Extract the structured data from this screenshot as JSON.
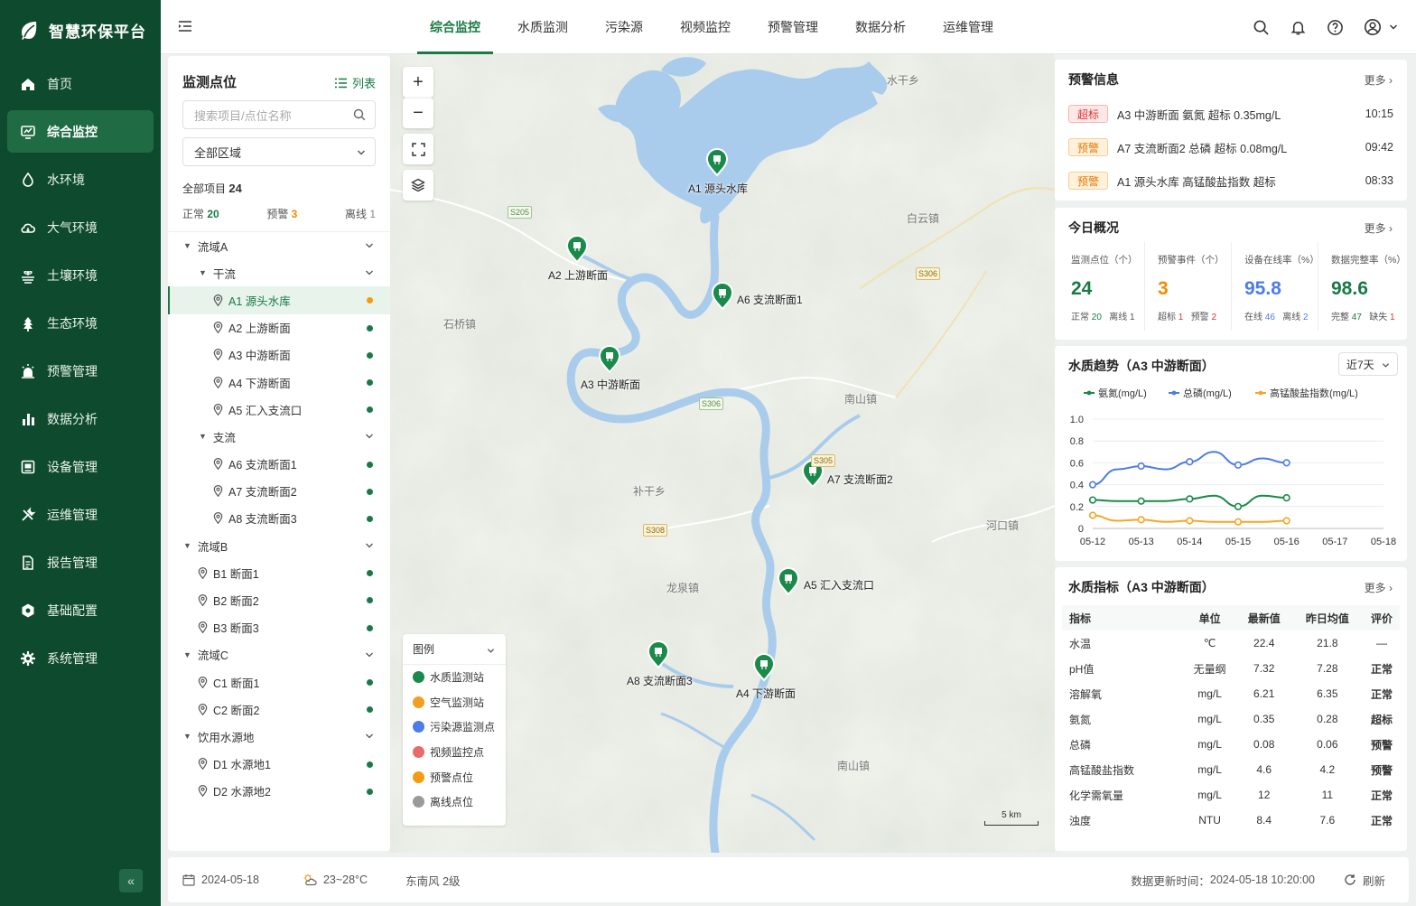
{
  "brand": {
    "title": "智慧环保平台"
  },
  "nav": {
    "items": [
      {
        "label": "首页",
        "icon": "home-icon"
      },
      {
        "label": "综合监控",
        "icon": "monitor-icon",
        "active": true
      },
      {
        "label": "水环境",
        "icon": "water-drop-icon"
      },
      {
        "label": "大气环境",
        "icon": "cloud-icon"
      },
      {
        "label": "土壤环境",
        "icon": "soil-icon"
      },
      {
        "label": "生态环境",
        "icon": "tree-icon"
      },
      {
        "label": "预警管理",
        "icon": "alarm-icon"
      },
      {
        "label": "数据分析",
        "icon": "bar-chart-icon"
      },
      {
        "label": "设备管理",
        "icon": "device-icon"
      },
      {
        "label": "运维管理",
        "icon": "tools-icon"
      },
      {
        "label": "报告管理",
        "icon": "report-icon"
      },
      {
        "label": "基础配置",
        "icon": "config-icon"
      },
      {
        "label": "系统管理",
        "icon": "gear-icon"
      }
    ]
  },
  "tabs": [
    "综合监控",
    "水质监测",
    "污染源",
    "视频监控",
    "预警管理",
    "数据分析",
    "运维管理"
  ],
  "left_panel": {
    "title": "监测点位",
    "list_label": "列表",
    "search_placeholder": "搜索项目/点位名称",
    "region_select": "全部区域",
    "total_label": "全部项目",
    "total_value": "24",
    "normal_label": "正常",
    "normal_value": "20",
    "warn_label": "预警",
    "warn_value": "3",
    "offline_label": "离线",
    "offline_value": "1",
    "tree": [
      {
        "type": "group",
        "label": "流域A"
      },
      {
        "type": "sub",
        "label": "干流"
      },
      {
        "type": "leaf2",
        "label": "A1 源头水库",
        "status": "warn",
        "selected": true
      },
      {
        "type": "leaf2",
        "label": "A2 上游断面",
        "status": "normal"
      },
      {
        "type": "leaf2",
        "label": "A3 中游断面",
        "status": "normal"
      },
      {
        "type": "leaf2",
        "label": "A4 下游断面",
        "status": "normal"
      },
      {
        "type": "leaf2",
        "label": "A5 汇入支流口",
        "status": "normal"
      },
      {
        "type": "sub",
        "label": "支流"
      },
      {
        "type": "leaf2",
        "label": "A6 支流断面1",
        "status": "normal"
      },
      {
        "type": "leaf2",
        "label": "A7 支流断面2",
        "status": "normal"
      },
      {
        "type": "leaf2",
        "label": "A8 支流断面3",
        "status": "normal"
      },
      {
        "type": "group",
        "label": "流域B"
      },
      {
        "type": "leaf1",
        "label": "B1 断面1",
        "status": "normal"
      },
      {
        "type": "leaf1",
        "label": "B2 断面2",
        "status": "normal"
      },
      {
        "type": "leaf1",
        "label": "B3 断面3",
        "status": "normal"
      },
      {
        "type": "group",
        "label": "流域C"
      },
      {
        "type": "leaf1",
        "label": "C1 断面1",
        "status": "normal"
      },
      {
        "type": "leaf1",
        "label": "C2 断面2",
        "status": "normal"
      },
      {
        "type": "group",
        "label": "饮用水源地"
      },
      {
        "type": "leaf1",
        "label": "D1 水源地1",
        "status": "normal"
      },
      {
        "type": "leaf1",
        "label": "D2 水源地2",
        "status": "normal"
      }
    ]
  },
  "map": {
    "places": [
      "水干乡",
      "白云镇",
      "石桥镇",
      "南山镇",
      "补干乡",
      "河口镇",
      "龙泉镇",
      "南山镇"
    ],
    "roads": [
      "S205",
      "S306",
      "S306",
      "S305",
      "S308"
    ],
    "markers": [
      "A1 源头水库",
      "A2 上游断面",
      "A6 支流断面1",
      "A3 中游断面",
      "A7 支流断面2",
      "A5 汇入支流口",
      "A8 支流断面3",
      "A4 下游断面"
    ],
    "legend_title": "图例",
    "legend": [
      {
        "label": "水质监测站",
        "color": "#1a8a4a"
      },
      {
        "label": "空气监测站",
        "color": "#f0a020"
      },
      {
        "label": "污染源监测点",
        "color": "#4d7be8"
      },
      {
        "label": "视频监控点",
        "color": "#e86a6a"
      },
      {
        "label": "预警点位",
        "color": "#f39c12"
      },
      {
        "label": "离线点位",
        "color": "#9a9a9a"
      }
    ],
    "scale_label": "5 km"
  },
  "alerts": {
    "title": "预警信息",
    "more": "更多",
    "items": [
      {
        "level": "超标",
        "kind": "red",
        "text": "A3 中游断面 氨氮 超标 0.35mg/L",
        "time": "10:15"
      },
      {
        "level": "预警",
        "kind": "org",
        "text": "A7 支流断面2 总磷 超标 0.08mg/L",
        "time": "09:42"
      },
      {
        "level": "预警",
        "kind": "org",
        "text": "A1 源头水库 高锰酸盐指数 超标",
        "time": "08:33"
      }
    ]
  },
  "overview": {
    "title": "今日概况",
    "more": "更多",
    "cells": [
      {
        "label": "监测点位（个）",
        "value": "24",
        "color": "#1a7a46",
        "s1_label": "正常",
        "s1_value": "20",
        "s1_class": "g",
        "s2_label": "离线",
        "s2_value": "1",
        "s2_class": ""
      },
      {
        "label": "预警事件（个）",
        "value": "3",
        "color": "#f08c00",
        "s1_label": "超标",
        "s1_value": "1",
        "s1_class": "r",
        "s2_label": "预警",
        "s2_value": "2",
        "s2_class": "r"
      },
      {
        "label": "设备在线率（%）",
        "value": "95.8",
        "color": "#4d7be8",
        "s1_label": "在线",
        "s1_value": "46",
        "s1_class": "b",
        "s2_label": "离线",
        "s2_value": "2",
        "s2_class": "b"
      },
      {
        "label": "数据完整率（%）",
        "value": "98.6",
        "color": "#1a7a46",
        "s1_label": "完整",
        "s1_value": "47",
        "s1_class": "g",
        "s2_label": "缺失",
        "s2_value": "1",
        "s2_class": "r"
      }
    ]
  },
  "trend": {
    "title": "水质趋势（A3 中游断面）",
    "range": "近7天"
  },
  "chart_data": {
    "type": "line",
    "categories": [
      "05-12",
      "05-13",
      "05-14",
      "05-15",
      "05-16",
      "05-17",
      "05-18"
    ],
    "ylim": [
      0,
      1.0
    ],
    "yticks": [
      "0",
      "0.2",
      "0.4",
      "0.6",
      "0.8",
      "1.0"
    ],
    "legend_position": "top",
    "series": [
      {
        "name": "氨氮(mg/L)",
        "color": "#1a8a4a",
        "values": [
          0.26,
          0.25,
          0.25,
          0.25,
          0.27,
          0.3,
          0.2,
          0.3,
          0.28
        ]
      },
      {
        "name": "总磷(mg/L)",
        "color": "#4d7be8",
        "values": [
          0.4,
          0.54,
          0.57,
          0.54,
          0.61,
          0.7,
          0.58,
          0.64,
          0.6
        ]
      },
      {
        "name": "高锰酸盐指数(mg/L)",
        "color": "#f5a623",
        "values": [
          0.12,
          0.07,
          0.08,
          0.06,
          0.07,
          0.06,
          0.06,
          0.06,
          0.07
        ]
      }
    ],
    "x_points": [
      0,
      0.5,
      1,
      1.5,
      2,
      2.5,
      3,
      3.5,
      4
    ]
  },
  "quality": {
    "title": "水质指标（A3 中游断面）",
    "more": "更多",
    "headers": [
      "指标",
      "单位",
      "最新值",
      "昨日均值",
      "评价"
    ],
    "rows": [
      {
        "name": "水温",
        "unit": "℃",
        "latest": "22.4",
        "avg": "21.8",
        "eval": "—",
        "cls": ""
      },
      {
        "name": "pH值",
        "unit": "无量纲",
        "latest": "7.32",
        "avg": "7.28",
        "eval": "正常",
        "cls": "ev-g"
      },
      {
        "name": "溶解氧",
        "unit": "mg/L",
        "latest": "6.21",
        "avg": "6.35",
        "eval": "正常",
        "cls": "ev-g"
      },
      {
        "name": "氨氮",
        "unit": "mg/L",
        "latest": "0.35",
        "avg": "0.28",
        "eval": "超标",
        "cls": "ev-r"
      },
      {
        "name": "总磷",
        "unit": "mg/L",
        "latest": "0.08",
        "avg": "0.06",
        "eval": "预警",
        "cls": "ev-o"
      },
      {
        "name": "高锰酸盐指数",
        "unit": "mg/L",
        "latest": "4.6",
        "avg": "4.2",
        "eval": "预警",
        "cls": "ev-o"
      },
      {
        "name": "化学需氧量",
        "unit": "mg/L",
        "latest": "12",
        "avg": "11",
        "eval": "正常",
        "cls": "ev-g"
      },
      {
        "name": "浊度",
        "unit": "NTU",
        "latest": "8.4",
        "avg": "7.6",
        "eval": "正常",
        "cls": "ev-g"
      }
    ]
  },
  "status": {
    "date": "2024-05-18",
    "temp": "23~28°C",
    "wind": "东南风 2级",
    "update_label": "数据更新时间：",
    "update_time": "2024-05-18 10:20:00",
    "refresh": "刷新"
  }
}
